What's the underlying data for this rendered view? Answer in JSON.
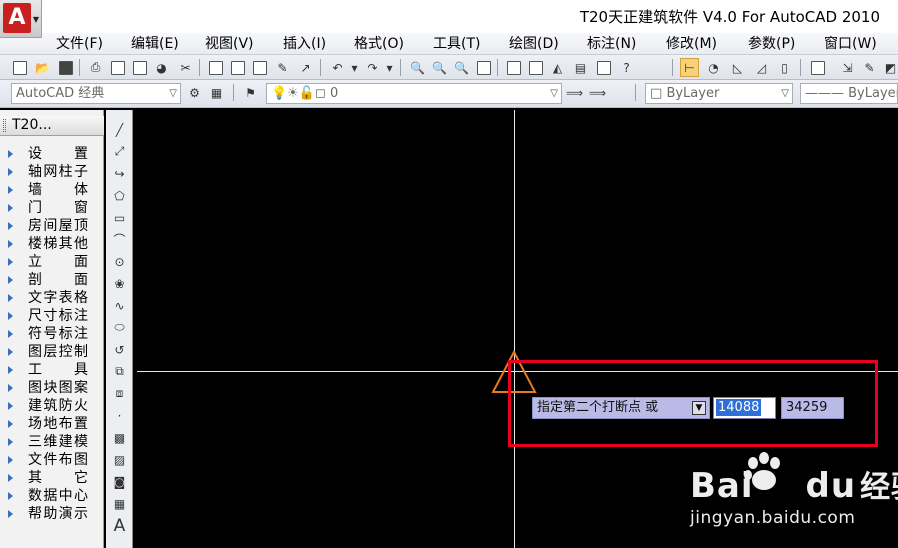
{
  "window": {
    "title": "T20天正建筑软件 V4.0 For AutoCAD 2010",
    "logo_letter": "A"
  },
  "menu": {
    "items": [
      "文件(F)",
      "编辑(E)",
      "视图(V)",
      "插入(I)",
      "格式(O)",
      "工具(T)",
      "绘图(D)",
      "标注(N)",
      "修改(M)",
      "参数(P)",
      "窗口(W)"
    ]
  },
  "toolbar2": {
    "workspace": "AutoCAD 经典",
    "layer": "0",
    "color": "ByLayer",
    "linetype": "ByLayer"
  },
  "panel": {
    "title": "T20...",
    "items": [
      "设置",
      "轴网柱子",
      "墙体",
      "门窗",
      "房间屋顶",
      "楼梯其他",
      "立面",
      "剖面",
      "文字表格",
      "尺寸标注",
      "符号标注",
      "图层控制",
      "工具",
      "图块图案",
      "建筑防火",
      "场地布置",
      "三维建模",
      "文件布图",
      "其它",
      "数据中心",
      "帮助演示"
    ]
  },
  "dynamic_input": {
    "prompt": "指定第二个打断点 或",
    "x_value": "14088",
    "y_value": "34259"
  },
  "watermark": {
    "brand": "Bai",
    "brand2": "du",
    "brand_cn": "经验",
    "url": "jingyan.baidu.com"
  },
  "colors": {
    "canvas_bg": "#000000",
    "highlight": "#e8001c",
    "cursor": "#e87a1e",
    "prompt_bg": "#b9bbe6",
    "selected_text": "#2f6fd8"
  }
}
